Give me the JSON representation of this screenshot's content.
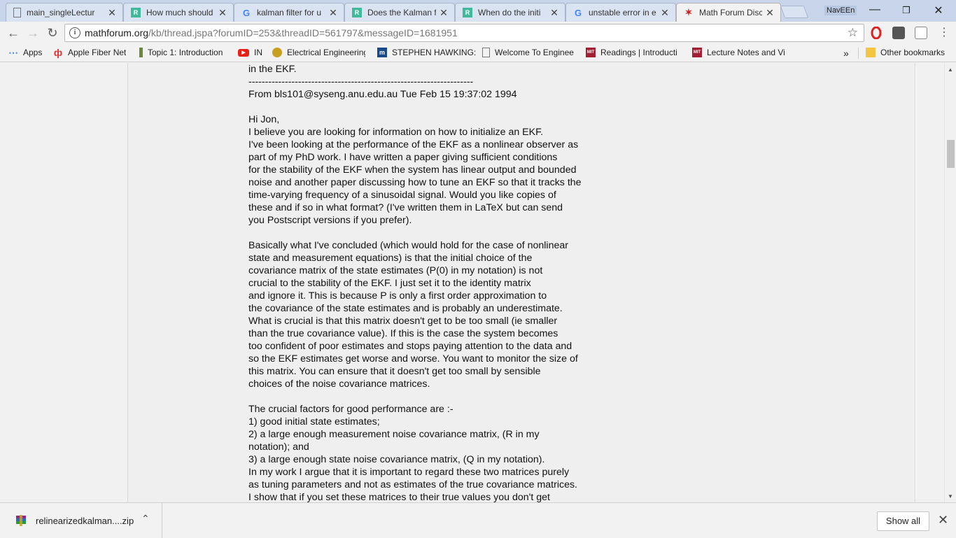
{
  "tabs": [
    {
      "title": "main_singleLectur",
      "icon": "document-icon",
      "active": false
    },
    {
      "title": "How much should",
      "icon": "researchgate-icon",
      "active": false
    },
    {
      "title": "kalman filter for u",
      "icon": "google-icon",
      "active": false
    },
    {
      "title": "Does the Kalman f",
      "icon": "researchgate-icon",
      "active": false
    },
    {
      "title": "When do the initi",
      "icon": "researchgate-icon",
      "active": false
    },
    {
      "title": "unstable error in e",
      "icon": "google-icon",
      "active": false
    },
    {
      "title": "Math Forum Discu",
      "icon": "mathforum-icon",
      "active": true
    }
  ],
  "profile_name": "NavEEn",
  "address_bar": {
    "host": "mathforum.org",
    "path": "/kb/thread.jspa?forumID=253&threadID=561797&messageID=1681951"
  },
  "bookmarks": [
    {
      "label": "Apps",
      "icon": "apps-grid-icon"
    },
    {
      "label": "Apple Fiber Net",
      "icon": "apple-fiber-icon"
    },
    {
      "label": "Topic 1: Introduction",
      "icon": "plug-icon"
    },
    {
      "label": "IN",
      "icon": "youtube-icon"
    },
    {
      "label": "Electrical Engineering",
      "icon": "ee-icon"
    },
    {
      "label": "STEPHEN HAWKING:",
      "icon": "m-logo-icon"
    },
    {
      "label": "Welcome To Enginee",
      "icon": "document-icon"
    },
    {
      "label": "Readings | Introducti",
      "icon": "mit-ocw-icon"
    },
    {
      "label": "Lecture Notes and Vi",
      "icon": "mit-ocw-icon"
    }
  ],
  "other_bookmarks_label": "Other bookmarks",
  "message_lines": [
    "in the EKF.",
    "--------------------------------------------------------------------",
    "From bls101@syseng.anu.edu.au Tue Feb 15 19:37:02 1994",
    "",
    "Hi Jon,",
    "I believe you are looking for information on how to initialize an EKF.",
    "I've been looking at the performance of the EKF as a nonlinear observer as",
    "part of my PhD work. I have written a paper giving sufficient conditions",
    "for the stability of the EKF when the system has linear output and bounded",
    "noise and another paper discussing how to tune an EKF so that it tracks the",
    "time-varying frequency of a sinusoidal signal. Would you like copies of",
    "these and if so in what format? (I've written them in LaTeX but can send",
    "you Postscript versions if you prefer).",
    "",
    "Basically what I've concluded (which would hold for the case of nonlinear",
    "state and measurement equations) is that the initial choice of the",
    "covariance matrix of the state estimates (P(0) in my notation) is not",
    "crucial to the stability of the EKF. I just set it to the identity matrix",
    "and ignore it. This is because P is only a first order approximation to",
    "the covariance of the state estimates and is probably an underestimate.",
    "What is crucial is that this matrix doesn't get to be too small (ie smaller",
    "than the true covariance value). If this is the case the system becomes",
    "too confident of poor estimates and stops paying attention to the data and",
    "so the EKF estimates get worse and worse. You want to monitor the size of",
    "this matrix. You can ensure that it doesn't get too small by sensible",
    "choices of the noise covariance matrices.",
    "",
    "The crucial factors for good performance are :-",
    "1) good initial state estimates;",
    "2) a large enough measurement noise covariance matrix, (R in my",
    "notation); and",
    "3) a large enough state noise covariance matrix, (Q in my notation).",
    "In my work I argue that it is important to regard these two matrices purely",
    "as tuning parameters and not as estimates of the true covariance matrices.",
    "I show that if you set these matrices to their true values you don't get"
  ],
  "download": {
    "filename": "relinearizedkalman....zip",
    "show_all_label": "Show all"
  },
  "colors": {
    "tabstrip": "#c8d5ea",
    "opera_red": "#e0201f",
    "mathforum_red": "#cc2222"
  }
}
